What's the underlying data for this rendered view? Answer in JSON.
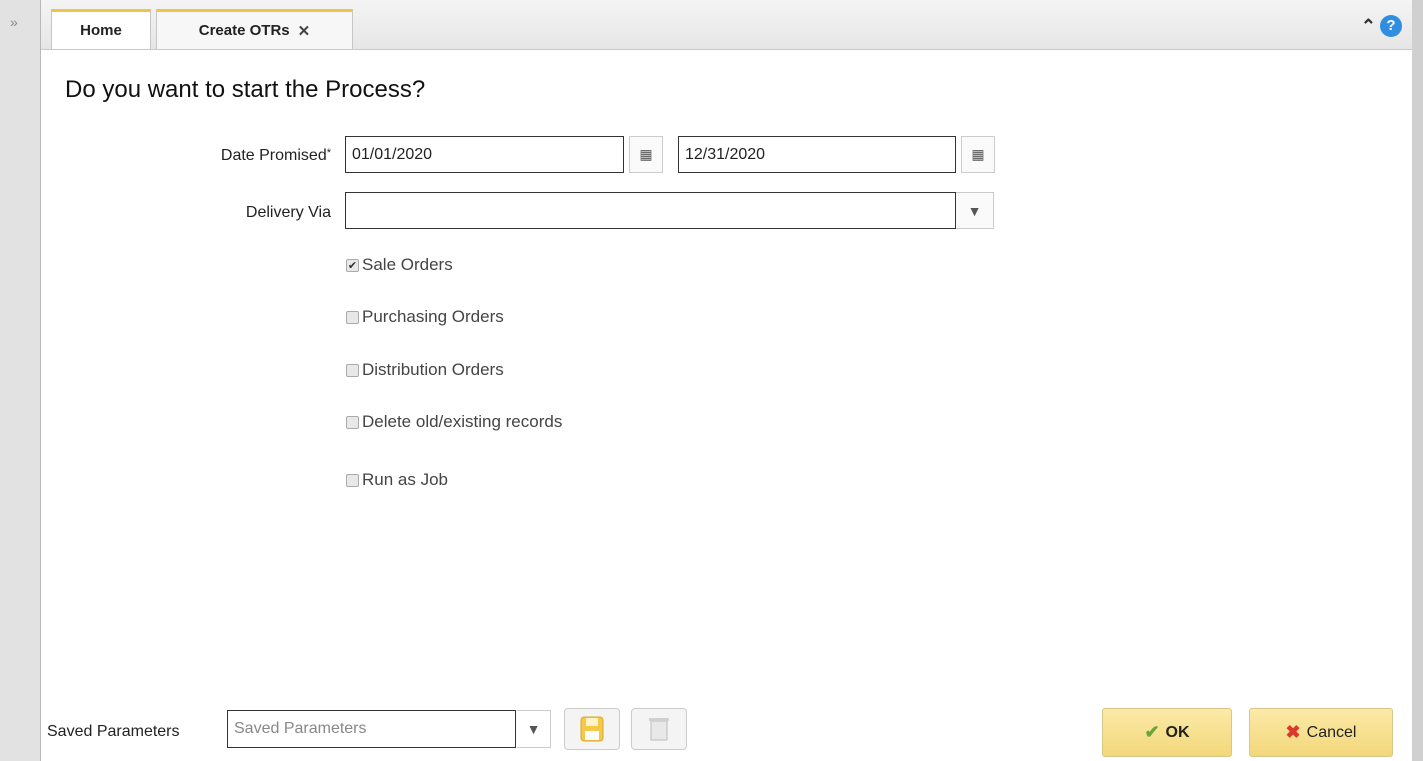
{
  "tabs": [
    {
      "label": "Home"
    },
    {
      "label": "Create OTRs",
      "close": "✕"
    }
  ],
  "header_icons": {
    "collapse": "≈",
    "help": "?"
  },
  "form": {
    "title": "Do you want to start the Process?",
    "date_promised": {
      "label": "Date Promised",
      "required_mark": "*",
      "from": "01/01/2020",
      "to": "12/31/2020"
    },
    "delivery_via": {
      "label": "Delivery Via",
      "value": ""
    },
    "checkboxes": [
      {
        "label": "Sale Orders",
        "checked": true
      },
      {
        "label": "Purchasing Orders",
        "checked": false
      },
      {
        "label": "Distribution Orders",
        "checked": false
      },
      {
        "label": "Delete old/existing records",
        "checked": false
      },
      {
        "label": "Run as Job",
        "checked": false
      }
    ]
  },
  "footer": {
    "saved_parameters_label": "Saved Parameters",
    "saved_parameters_placeholder": "Saved Parameters",
    "ok_label": "OK",
    "cancel_label": "Cancel"
  },
  "colors": {
    "tab_accent": "#f3c24a",
    "button_yellow": "#f3d77a",
    "help_blue": "#2f8ee0"
  }
}
